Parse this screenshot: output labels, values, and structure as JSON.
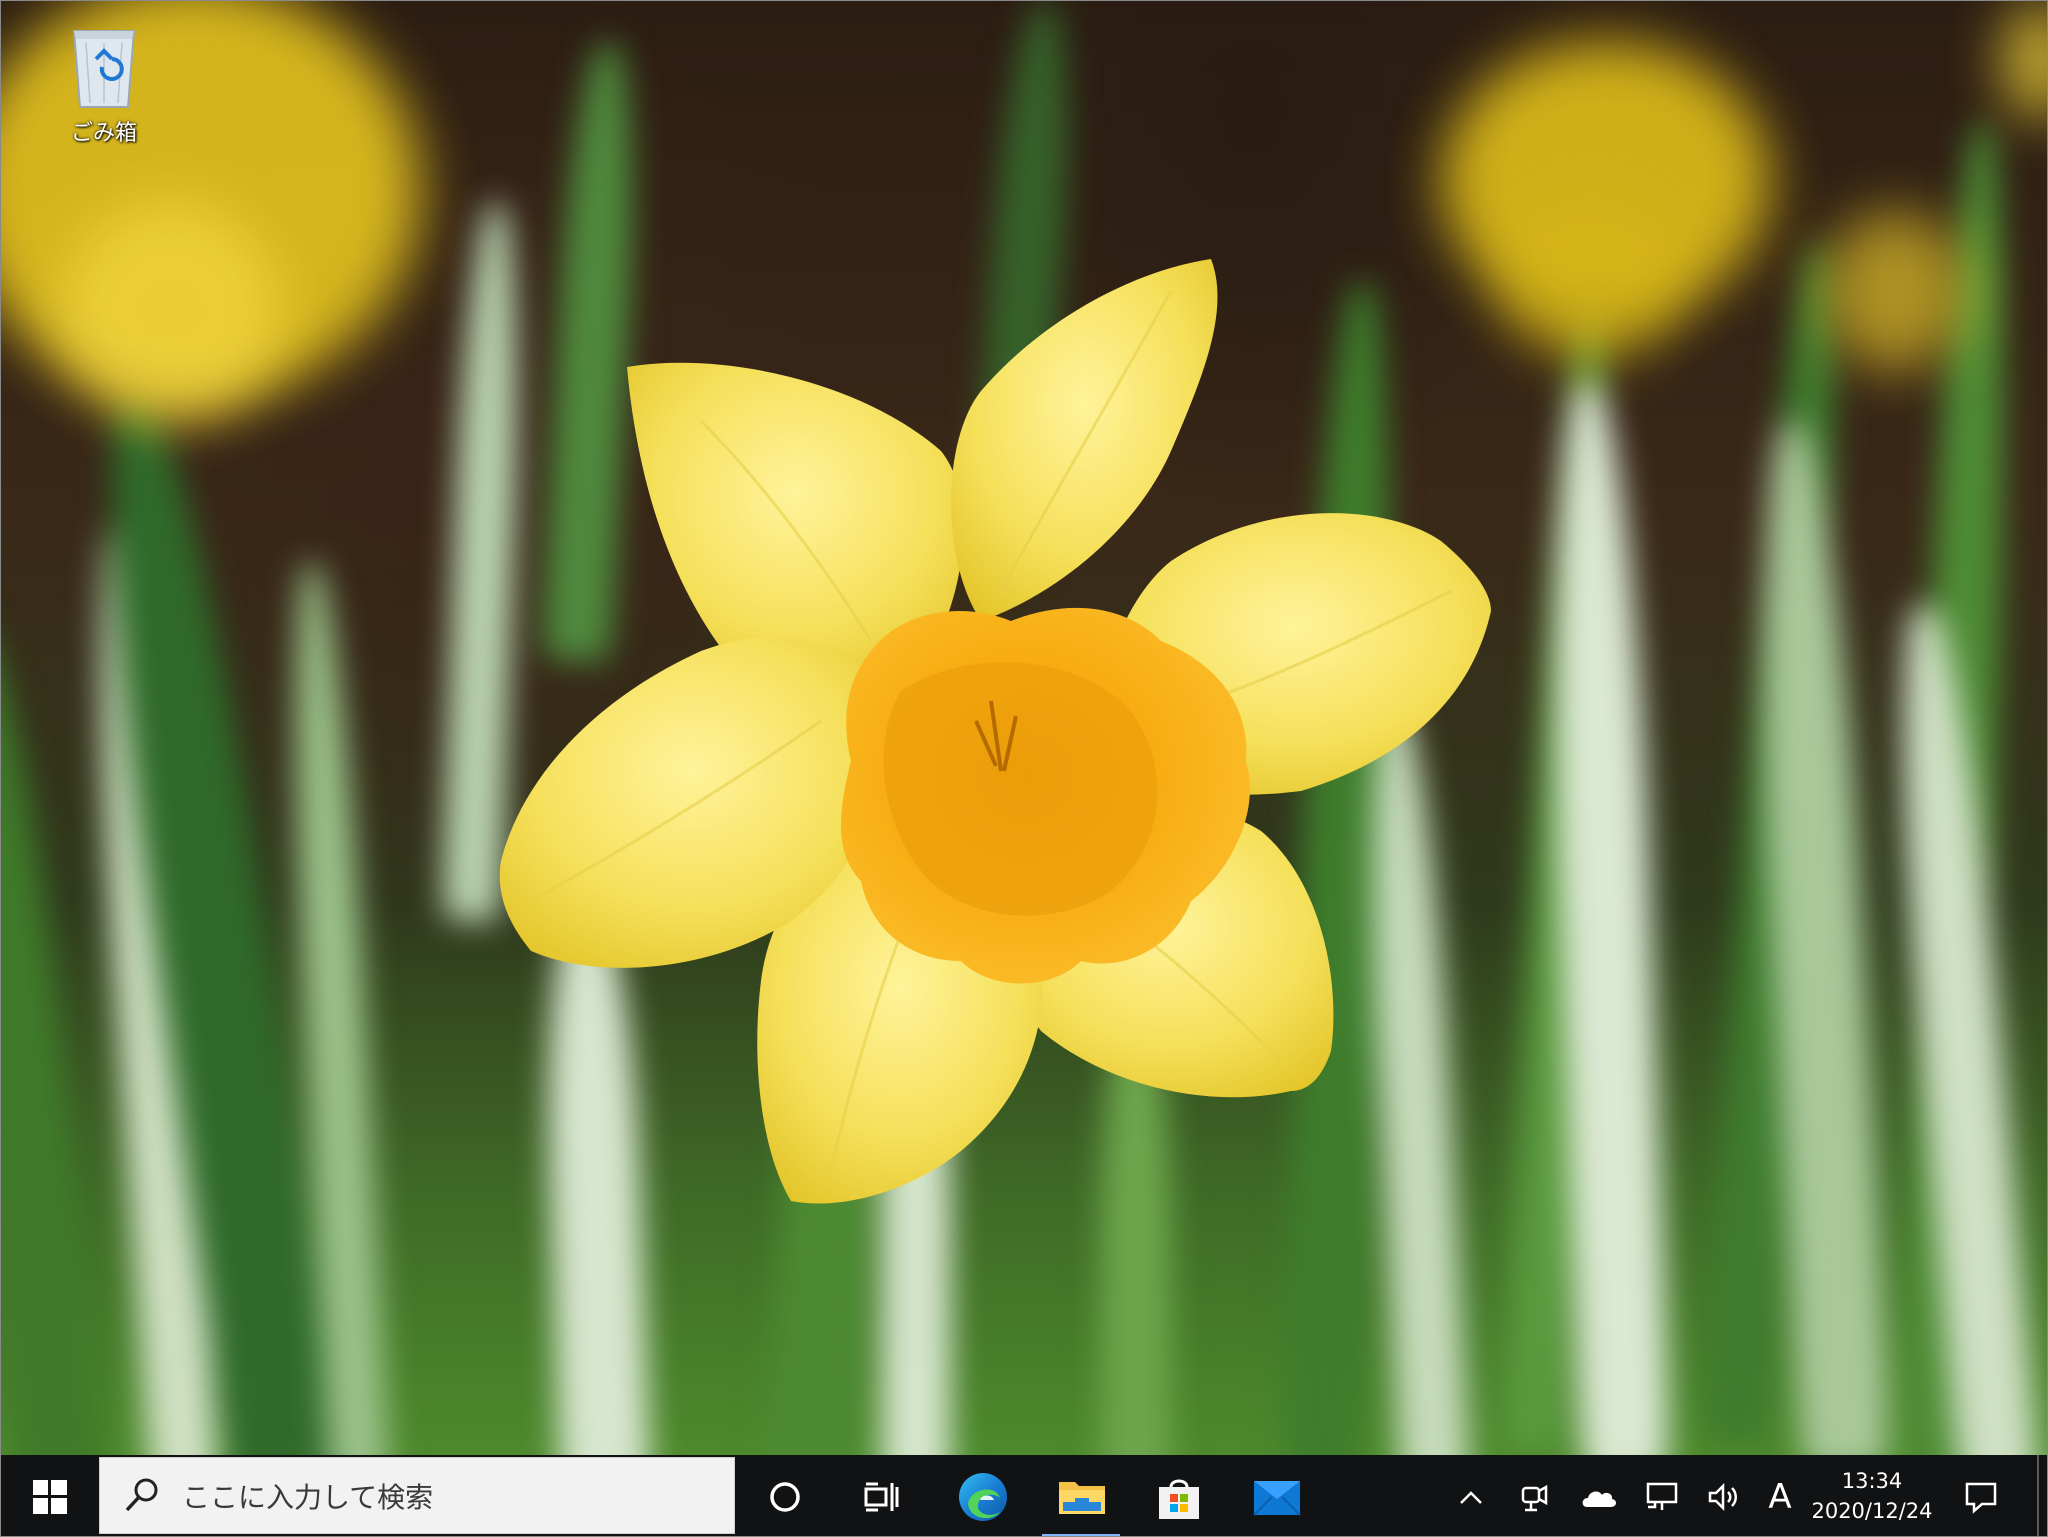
{
  "desktop": {
    "icons": [
      {
        "label": "ごみ箱",
        "icon": "recycle-bin-icon"
      }
    ]
  },
  "wallpaper": {
    "subject": "daffodil",
    "colors": {
      "petal": "#f5e05a",
      "trumpet": "#f7ad12",
      "background": "#2c1d12",
      "foliage": "#4d8a2c"
    }
  },
  "taskbar": {
    "background": "#111214",
    "start": {
      "icon": "windows-logo-icon"
    },
    "search": {
      "placeholder": "ここに入力して検索",
      "icon": "search-icon"
    },
    "buttons": [
      {
        "name": "cortana",
        "icon": "cortana-icon"
      },
      {
        "name": "task-view",
        "icon": "task-view-icon"
      },
      {
        "name": "edge",
        "icon": "edge-icon"
      },
      {
        "name": "file-explorer",
        "icon": "folder-icon",
        "active": true
      },
      {
        "name": "microsoft-store",
        "icon": "store-icon"
      },
      {
        "name": "mail",
        "icon": "mail-icon"
      }
    ],
    "tray": {
      "icons": [
        "chevron-up-icon",
        "meet-now-icon",
        "onedrive-icon",
        "network-icon",
        "volume-icon"
      ],
      "ime": "A",
      "time": "13:34",
      "date": "2020/12/24",
      "notifications_icon": "action-center-icon"
    }
  }
}
